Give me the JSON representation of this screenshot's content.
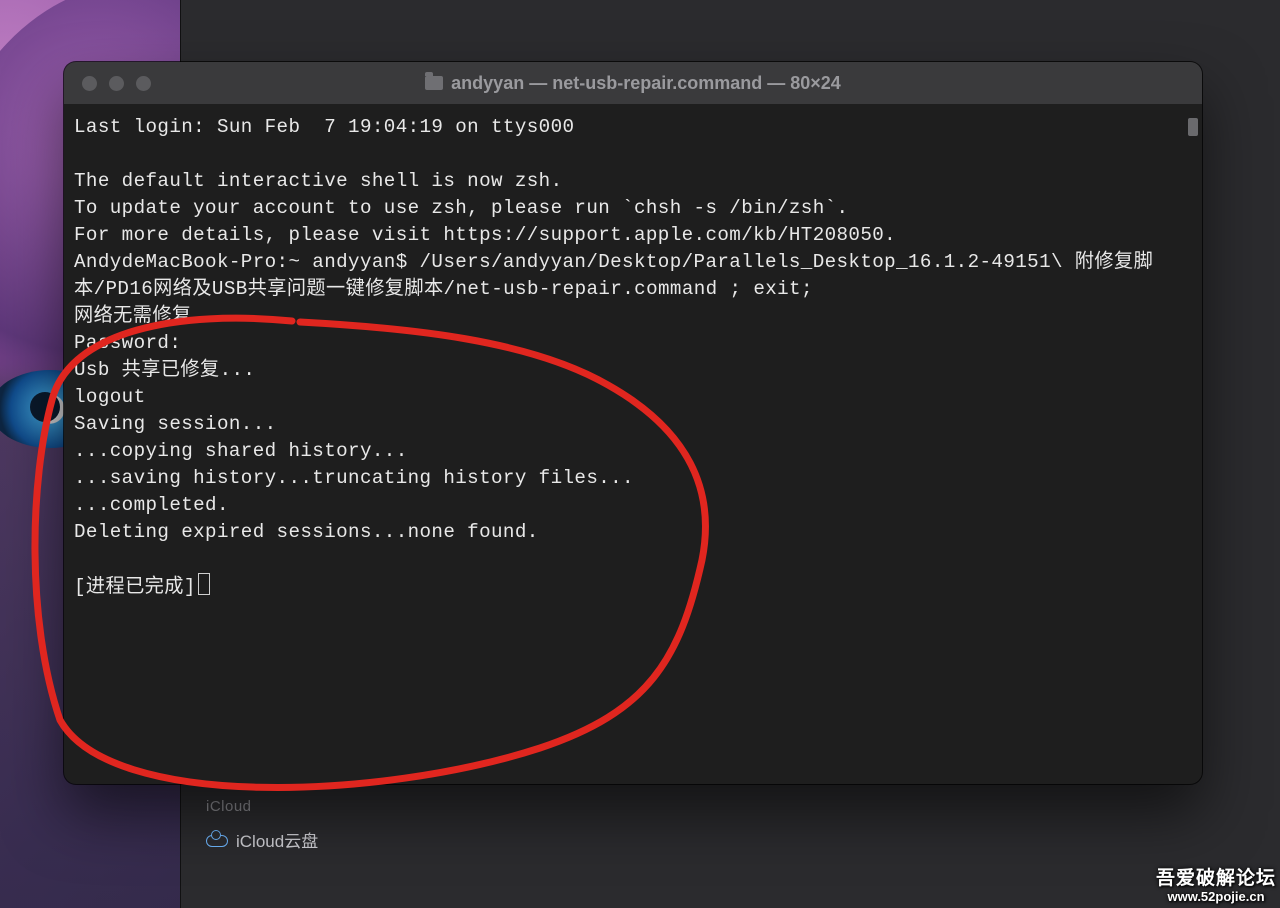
{
  "window": {
    "title": "andyyan — net-usb-repair.command — 80×24"
  },
  "terminal": {
    "lines": [
      "Last login: Sun Feb  7 19:04:19 on ttys000",
      "",
      "The default interactive shell is now zsh.",
      "To update your account to use zsh, please run `chsh -s /bin/zsh`.",
      "For more details, please visit https://support.apple.com/kb/HT208050.",
      "AndydeMacBook-Pro:~ andyyan$ /Users/andyyan/Desktop/Parallels_Desktop_16.1.2-49151\\ 附修复脚本/PD16网络及USB共享问题一键修复脚本/net-usb-repair.command ; exit;",
      "网络无需修复...",
      "Password:",
      "Usb 共享已修复...",
      "logout",
      "Saving session...",
      "...copying shared history...",
      "...saving history...truncating history files...",
      "...completed.",
      "Deleting expired sessions...none found.",
      "",
      "[进程已完成]"
    ]
  },
  "finder": {
    "section": "iCloud",
    "item": "iCloud云盘"
  },
  "watermark": {
    "line1": "吾爱破解论坛",
    "line2": "www.52pojie.cn"
  }
}
